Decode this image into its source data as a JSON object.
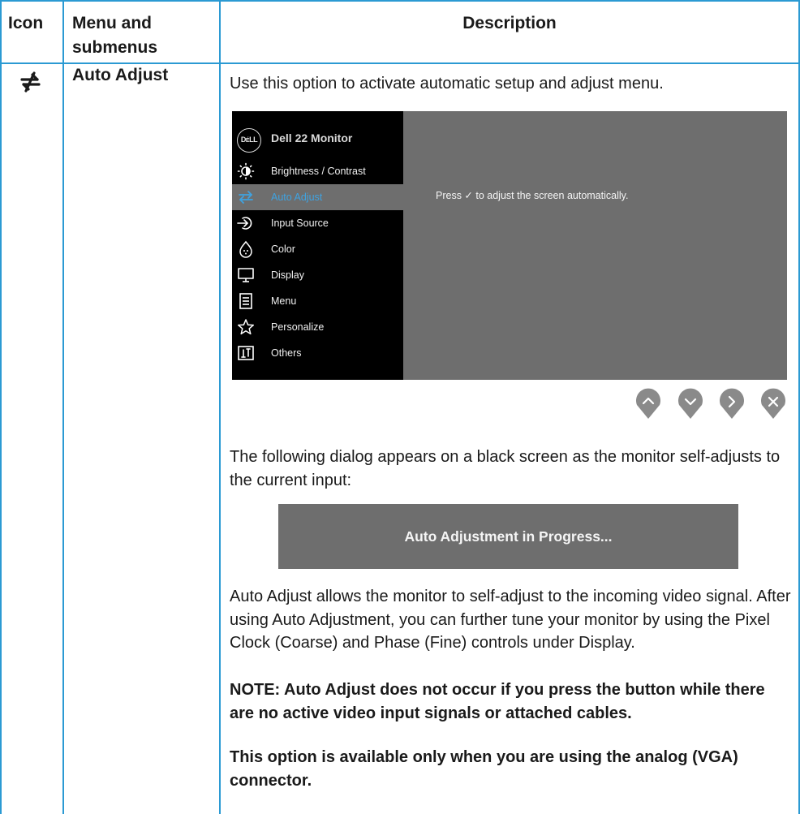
{
  "table": {
    "headers": {
      "icon": "Icon",
      "menu": "Menu and submenus",
      "description": "Description"
    },
    "row": {
      "icon_name": "auto-adjust-icon",
      "menu_label": "Auto Adjust",
      "intro": "Use this option to activate automatic setup and adjust menu.",
      "dialog_intro": "The following dialog appears on a black screen as the monitor self-adjusts to the current input:",
      "body": "Auto Adjust allows the monitor to self-adjust to the incoming video signal. After using Auto Adjustment, you can further tune your monitor by using the Pixel Clock (Coarse) and Phase (Fine) controls under Display.",
      "note": "NOTE: Auto Adjust does not occur if you press the button while there are no active video input signals or attached cables.",
      "vga_note": "This option is available only when you are using the analog (VGA) connector."
    }
  },
  "osd": {
    "logo_text": "DELL",
    "title": "Dell 22 Monitor",
    "items": [
      {
        "label": "Brightness / Contrast",
        "icon": "brightness-icon"
      },
      {
        "label": "Auto Adjust",
        "icon": "auto-adjust-icon",
        "selected": true
      },
      {
        "label": "Input Source",
        "icon": "input-source-icon"
      },
      {
        "label": "Color",
        "icon": "color-icon"
      },
      {
        "label": "Display",
        "icon": "display-icon"
      },
      {
        "label": "Menu",
        "icon": "menu-icon"
      },
      {
        "label": "Personalize",
        "icon": "star-icon"
      },
      {
        "label": "Others",
        "icon": "others-icon"
      }
    ],
    "message": "Press ✓ to adjust the screen automatically.",
    "buttons": [
      "up-button",
      "down-button",
      "right-button",
      "close-button"
    ]
  },
  "dialog": {
    "text": "Auto Adjustment in Progress..."
  },
  "colors": {
    "border": "#2b9ad3",
    "osd_bg": "#6e6e6e",
    "osd_menu": "#000000",
    "selected_label": "#3fa2e0"
  }
}
